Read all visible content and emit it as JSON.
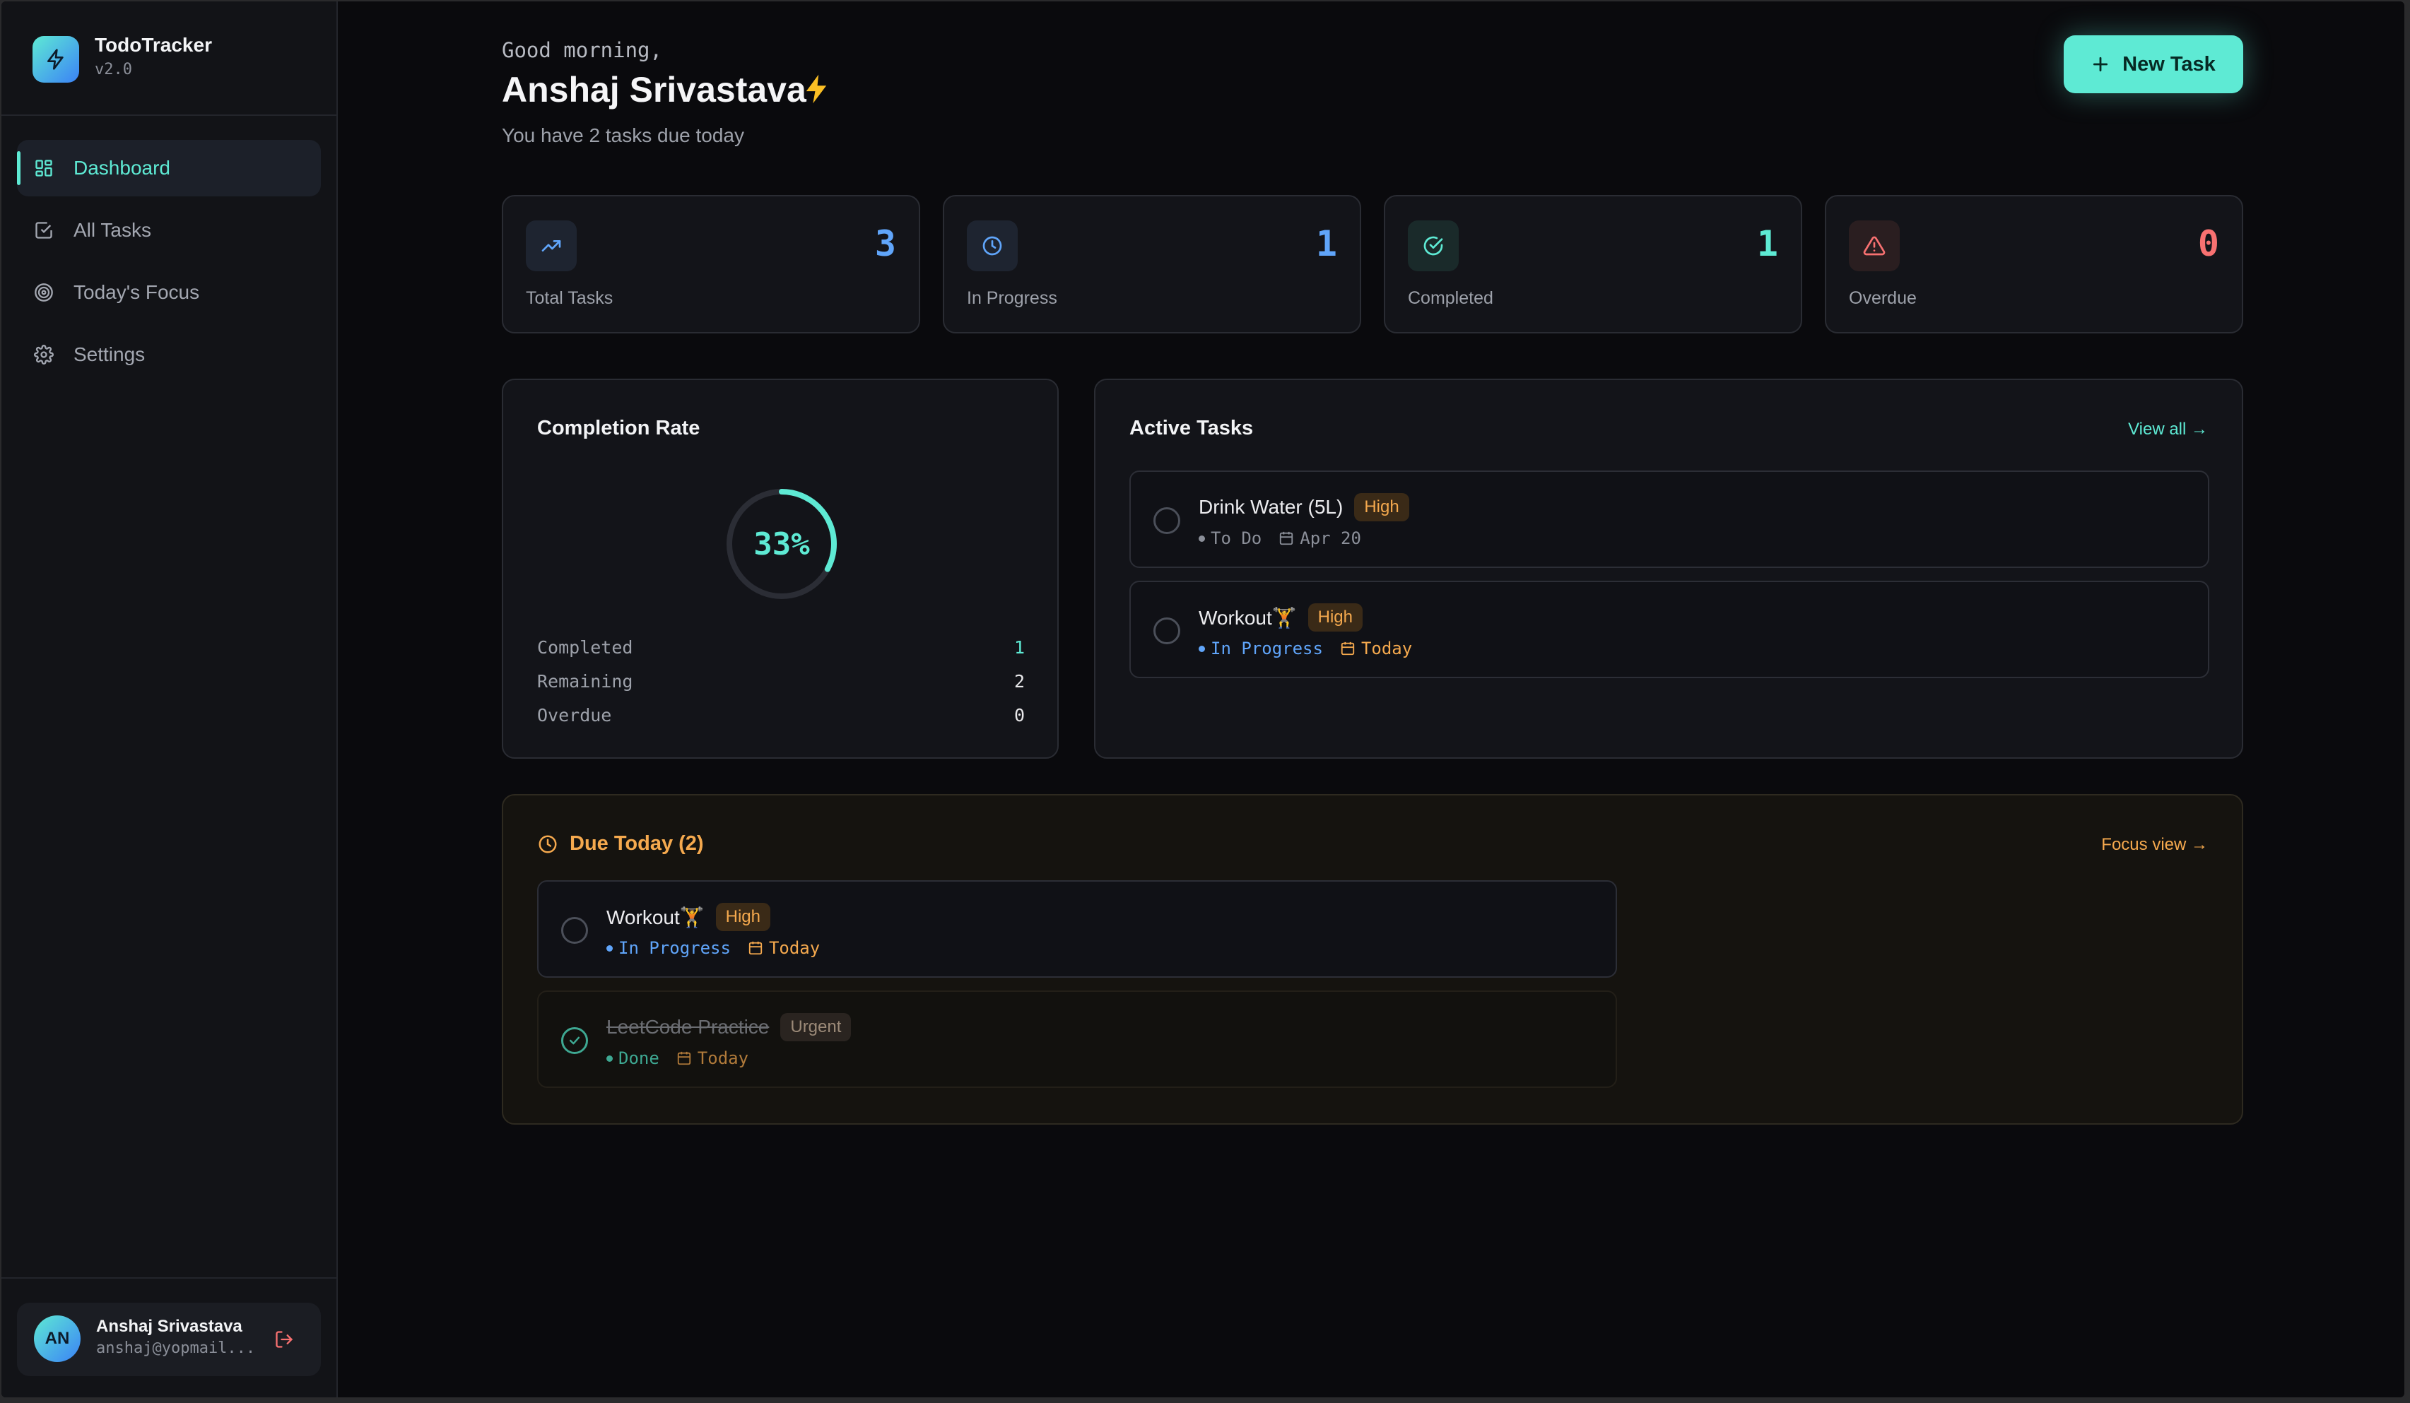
{
  "app": {
    "name": "TodoTracker",
    "version": "v2.0"
  },
  "nav": [
    {
      "label": "Dashboard",
      "icon": "grid-icon",
      "active": true
    },
    {
      "label": "All Tasks",
      "icon": "checkbox-icon"
    },
    {
      "label": "Today's Focus",
      "icon": "target-icon"
    },
    {
      "label": "Settings",
      "icon": "gear-icon"
    }
  ],
  "user": {
    "initials": "AN",
    "name": "Anshaj Srivastava",
    "email": "anshaj@yopmail..."
  },
  "header": {
    "greeting": "Good morning,",
    "name": "Anshaj Srivastava",
    "subtitle": "You have 2 tasks due today",
    "new_task_label": "New Task"
  },
  "stats": [
    {
      "label": "Total Tasks",
      "value": "3",
      "color": "#60a5fa",
      "icon": "trending-up-icon"
    },
    {
      "label": "In Progress",
      "value": "1",
      "color": "#60a5fa",
      "icon": "clock-icon"
    },
    {
      "label": "Completed",
      "value": "1",
      "color": "#5eead4",
      "icon": "check-circle-icon"
    },
    {
      "label": "Overdue",
      "value": "0",
      "color": "#f87171",
      "icon": "alert-triangle-icon"
    }
  ],
  "completion": {
    "title": "Completion Rate",
    "percent_label": "33%",
    "percent": 0.33,
    "rows": [
      {
        "label": "Completed",
        "value": "1"
      },
      {
        "label": "Remaining",
        "value": "2"
      },
      {
        "label": "Overdue",
        "value": "0"
      }
    ]
  },
  "active_tasks": {
    "title": "Active Tasks",
    "view_all": "View all →",
    "items": [
      {
        "title": "Drink Water (5L)",
        "priority": "High",
        "status": "To Do",
        "date": "Apr 20"
      },
      {
        "title": "Workout🏋",
        "priority": "High",
        "status": "In Progress",
        "date": "Today"
      }
    ]
  },
  "due_today": {
    "title": "Due Today (2)",
    "focus_view": "Focus view →",
    "items": [
      {
        "title": "Workout🏋",
        "priority": "High",
        "status": "In Progress",
        "date": "Today"
      },
      {
        "title": "LeetCode Practice",
        "priority": "Urgent",
        "status": "Done",
        "date": "Today"
      }
    ]
  },
  "colors": {
    "accent": "#5eead4",
    "blue": "#60a5fa",
    "red": "#f87171",
    "orange": "#f5a94e"
  }
}
